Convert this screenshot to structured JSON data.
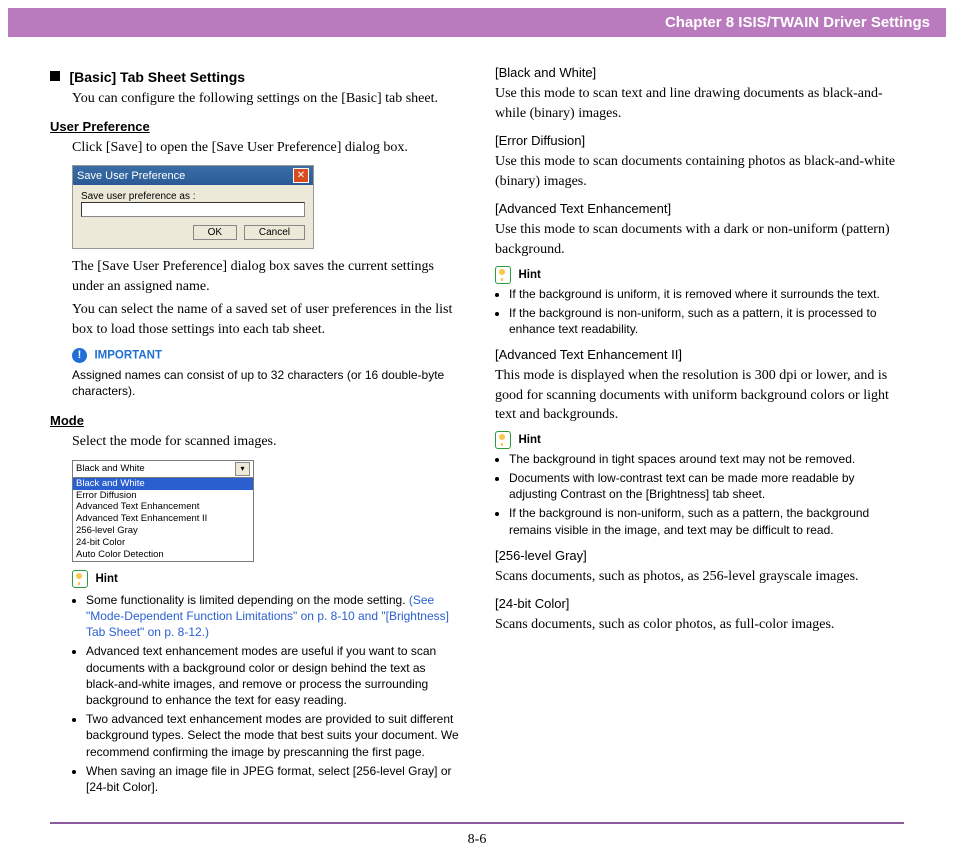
{
  "header": {
    "title": "Chapter 8   ISIS/TWAIN Driver Settings"
  },
  "left": {
    "basic_tab_title": "[Basic] Tab Sheet Settings",
    "basic_tab_body": "You can configure the following settings on the [Basic] tab sheet.",
    "user_pref_title": "User Preference",
    "user_pref_body": "Click [Save] to open the [Save User Preference] dialog box.",
    "dialog": {
      "title": "Save User Preference",
      "label": "Save user preference as :",
      "ok": "OK",
      "cancel": "Cancel"
    },
    "user_pref_after1": "The [Save User Preference] dialog box saves the current settings under an assigned name.",
    "user_pref_after2": "You can select the name of a saved set of user preferences in the list box to load those settings into each tab sheet.",
    "important_label": "IMPORTANT",
    "important_body": "Assigned names can consist of up to 32 characters (or 16 double-byte characters).",
    "mode_title": "Mode",
    "mode_body": "Select the mode for scanned images.",
    "mode_options": {
      "top": "Black and White",
      "selected": "Black and White",
      "items": [
        "Error Diffusion",
        "Advanced Text Enhancement",
        "Advanced Text Enhancement II",
        "256-level Gray",
        "24-bit Color",
        "Auto Color Detection"
      ]
    },
    "hint_label": "Hint",
    "hints": [
      {
        "text": "Some functionality is limited depending on the mode setting.",
        "link": "(See \"Mode-Dependent Function Limitations\" on p. 8-10 and \"[Brightness] Tab Sheet\" on p. 8-12.)"
      },
      {
        "text": "Advanced text enhancement modes are useful if you want to scan documents with a background color or design behind the text as black-and-white images, and remove or process the surrounding background to enhance the text for easy reading."
      },
      {
        "text": "Two advanced text enhancement modes are provided to suit different background types. Select the mode that best suits your document. We recommend confirming the image by prescanning the first page."
      },
      {
        "text": "When saving an image file in JPEG format, select [256-level Gray] or [24-bit Color]."
      }
    ]
  },
  "right": {
    "bw_head": "[Black and White]",
    "bw_body": "Use this mode to scan text and line drawing documents as black-and-while (binary) images.",
    "ed_head": "[Error Diffusion]",
    "ed_body": "Use this mode to scan documents containing photos as black-and-white (binary) images.",
    "ate_head": "[Advanced Text Enhancement]",
    "ate_body": "Use this mode to scan documents with a dark or non-uniform (pattern) background.",
    "hint_label1": "Hint",
    "ate_hints": [
      "If the background is uniform, it is removed where it surrounds the text.",
      "If the background is non-uniform, such as a pattern, it is processed to enhance text readability."
    ],
    "ate2_head": "[Advanced Text Enhancement II]",
    "ate2_body": "This mode is displayed when the resolution is 300 dpi or lower, and is good for scanning documents with uniform background colors or light text and backgrounds.",
    "hint_label2": "Hint",
    "ate2_hints": [
      "The background in tight spaces around text may not be removed.",
      "Documents with low-contrast text can be made more readable by adjusting Contrast on the [Brightness] tab sheet.",
      "If the background is non-uniform, such as a pattern, the background remains visible in the image, and text may be difficult to read."
    ],
    "gray_head": "[256-level Gray]",
    "gray_body": "Scans documents, such as photos, as 256-level grayscale images.",
    "color_head": "[24-bit Color]",
    "color_body": "Scans documents, such as color photos, as full-color images."
  },
  "footer": {
    "page": "8-6"
  }
}
